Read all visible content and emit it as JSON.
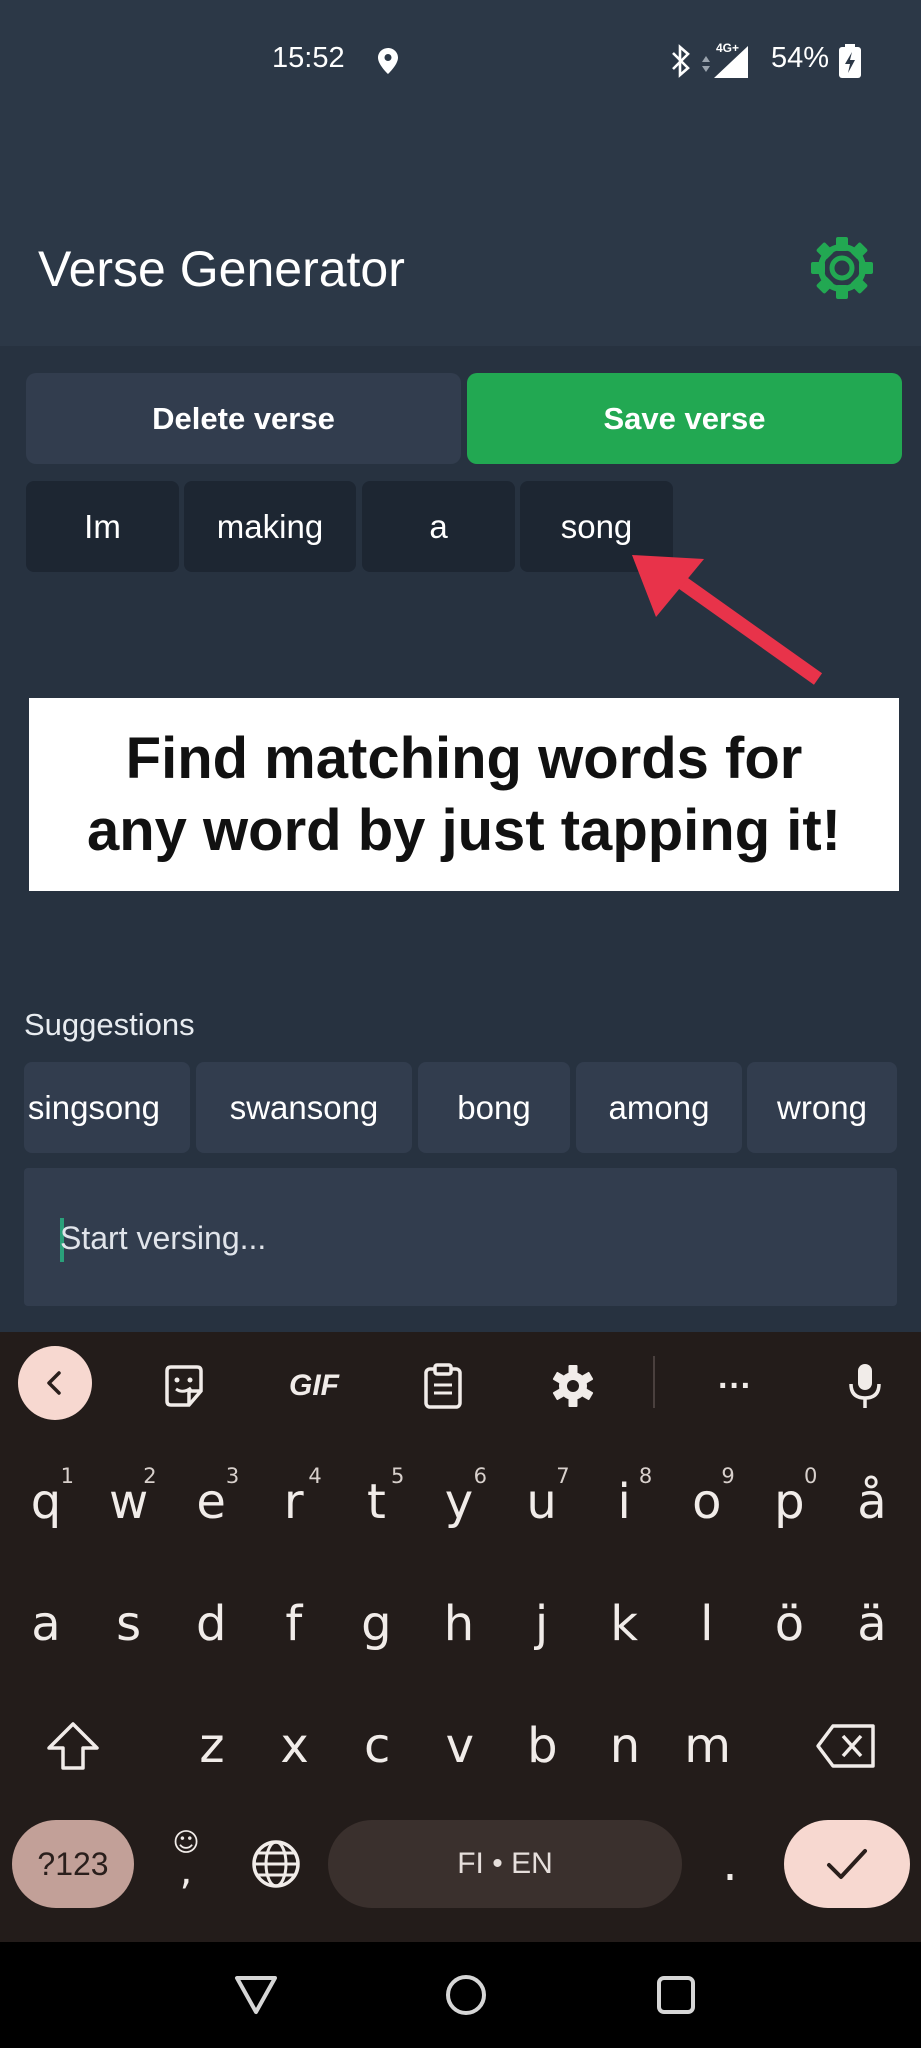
{
  "status_bar": {
    "time": "15:52",
    "network": "4G+",
    "battery": "54%"
  },
  "app": {
    "title": "Verse Generator"
  },
  "actions": {
    "delete_label": "Delete verse",
    "save_label": "Save verse"
  },
  "verse_words": [
    "Im",
    "making",
    "a",
    "song"
  ],
  "banner": {
    "line1": "Find matching words for",
    "line2": "any word by just tapping it!"
  },
  "suggestions": {
    "label": "Suggestions",
    "items": [
      "singsong",
      "swansong",
      "bong",
      "among",
      "wrong"
    ]
  },
  "input": {
    "placeholder": "Start versing..."
  },
  "keyboard": {
    "row1": [
      {
        "k": "q",
        "h": "1"
      },
      {
        "k": "w",
        "h": "2"
      },
      {
        "k": "e",
        "h": "3"
      },
      {
        "k": "r",
        "h": "4"
      },
      {
        "k": "t",
        "h": "5"
      },
      {
        "k": "y",
        "h": "6"
      },
      {
        "k": "u",
        "h": "7"
      },
      {
        "k": "i",
        "h": "8"
      },
      {
        "k": "o",
        "h": "9"
      },
      {
        "k": "p",
        "h": "0"
      },
      {
        "k": "å",
        "h": ""
      }
    ],
    "row2": [
      "a",
      "s",
      "d",
      "f",
      "g",
      "h",
      "j",
      "k",
      "l",
      "ö",
      "ä"
    ],
    "row3": [
      "z",
      "x",
      "c",
      "v",
      "b",
      "n",
      "m"
    ],
    "toolbar": {
      "gif": "GIF",
      "more": "···"
    },
    "num_label": "?123",
    "comma": ",",
    "emoji_glyph": "☺",
    "period": ".",
    "space_label": "FI • EN"
  },
  "colors": {
    "accent_green": "#22a852",
    "app_bg": "#2c3847",
    "arrow_red": "#e8334a"
  }
}
